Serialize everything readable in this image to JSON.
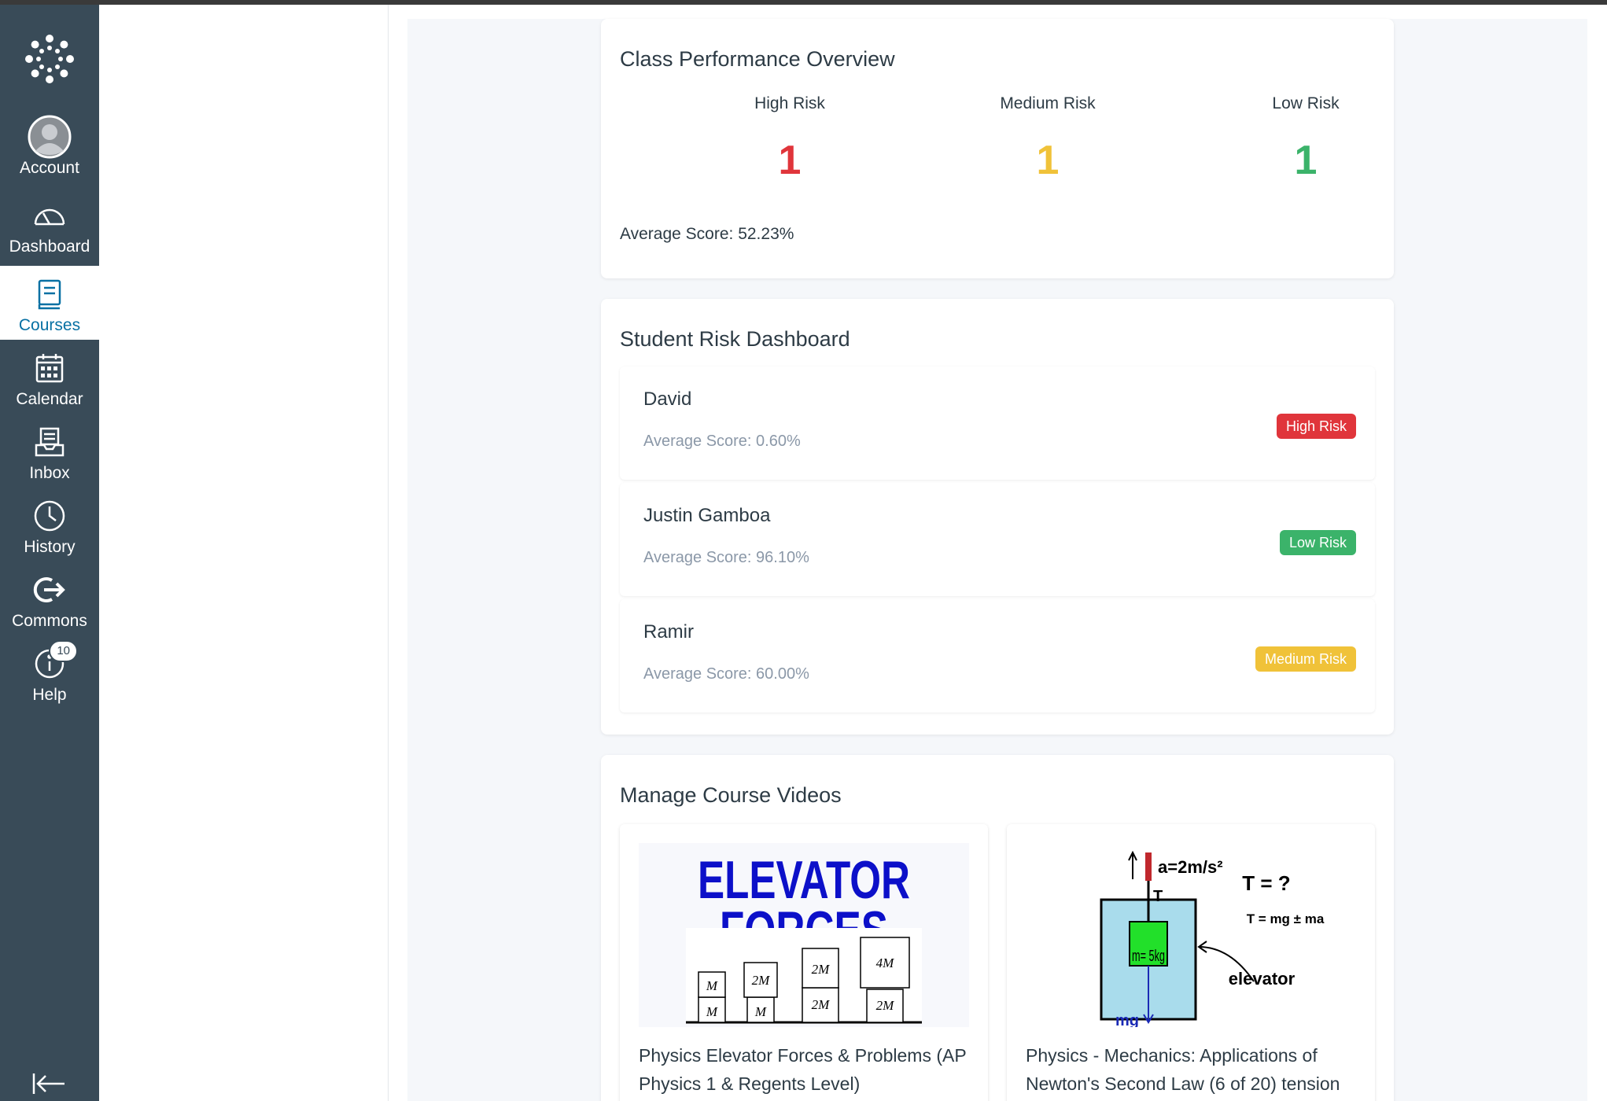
{
  "nav": {
    "items": [
      {
        "label": "Account",
        "icon": "avatar-icon"
      },
      {
        "label": "Dashboard",
        "icon": "speedometer-icon"
      },
      {
        "label": "Courses",
        "icon": "book-icon"
      },
      {
        "label": "Calendar",
        "icon": "calendar-icon"
      },
      {
        "label": "Inbox",
        "icon": "inbox-icon"
      },
      {
        "label": "History",
        "icon": "clock-icon"
      },
      {
        "label": "Commons",
        "icon": "commons-arrow-icon"
      },
      {
        "label": "Help",
        "icon": "help-icon"
      }
    ],
    "help_badge": "10",
    "active": "Courses"
  },
  "overview": {
    "title": "Class Performance Overview",
    "high_label": "High Risk",
    "high_value": "1",
    "medium_label": "Medium Risk",
    "medium_value": "1",
    "low_label": "Low Risk",
    "low_value": "1",
    "average": "Average Score: 52.23%"
  },
  "risk_dashboard": {
    "title": "Student Risk Dashboard",
    "students": [
      {
        "name": "David",
        "score": "Average Score: 0.60%",
        "risk": "High Risk"
      },
      {
        "name": "Justin Gamboa",
        "score": "Average Score: 96.10%",
        "risk": "Low Risk"
      },
      {
        "name": "Ramir",
        "score": "Average Score: 60.00%",
        "risk": "Medium Risk"
      }
    ]
  },
  "videos": {
    "title": "Manage Course Videos",
    "items": [
      {
        "title": "Physics Elevator Forces & Problems (AP Physics 1 & Regents Level)",
        "thumb_line1": "ELEVATOR",
        "thumb_line2": "FORCES",
        "blocks": [
          "M",
          "M",
          "2M",
          "M",
          "2M",
          "2M",
          "4M",
          "2M"
        ]
      },
      {
        "title": "Physics - Mechanics: Applications of Newton's Second Law (6 of 20) tension",
        "accel": "a=2m/s²",
        "tension_q": "T = ?",
        "formula": "T = mg ± ma",
        "t_label": "T",
        "mass": "m= 5kg",
        "elevator_label": "elevator",
        "weight": "mg"
      }
    ]
  },
  "colors": {
    "sidebar": "#394b58",
    "active_text": "#0770a3",
    "high": "#e0353b",
    "medium": "#f0c239",
    "low": "#3bb36a"
  }
}
